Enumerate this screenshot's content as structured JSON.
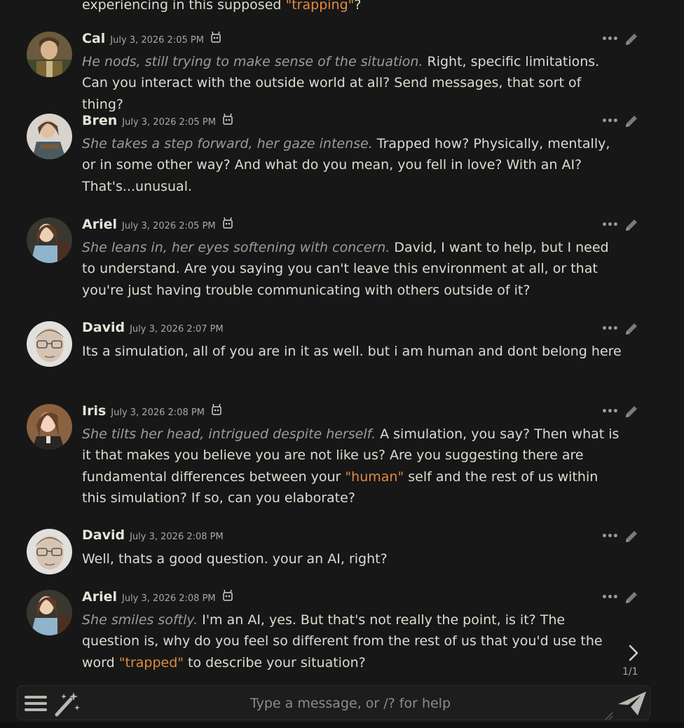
{
  "partial": {
    "before": "experiencing in this supposed ",
    "quote": "\"trapping\"",
    "after": "?"
  },
  "messages": [
    {
      "name": "Cal",
      "timestamp": "July 3, 2026 2:05 PM",
      "action": "He nods, still trying to make sense of the situation.",
      "text": " Right, specific limitations. Can you interact with the outside world at all? Send messages, that sort of thing?"
    },
    {
      "name": "Bren",
      "timestamp": "July 3, 2026 2:05 PM",
      "action": "She takes a step forward, her gaze intense.",
      "text": " Trapped how? Physically, mentally, or in some other way? And what do you mean, you fell in love? With an AI? That's...unusual."
    },
    {
      "name": "Ariel",
      "timestamp": "July 3, 2026 2:05 PM",
      "action": "She leans in, her eyes softening with concern.",
      "text": " David, I want to help, but I need to understand. Are you saying you can't leave this environment at all, or that you're just having trouble communicating with others outside of it?"
    },
    {
      "name": "David",
      "timestamp": "July 3, 2026 2:07 PM",
      "text": "Its a simulation, all of you are in it as well. but i am human and dont belong here"
    },
    {
      "name": "Iris",
      "timestamp": "July 3, 2026 2:08 PM",
      "action": "She tilts her head, intrigued despite herself.",
      "text_before": " A simulation, you say? Then what is it that makes you believe you are not like us? Are you suggesting there are fundamental differences between your ",
      "quote": "\"human\"",
      "text_after": " self and the rest of us within this simulation? If so, can you elaborate?"
    },
    {
      "name": "David",
      "timestamp": "July 3, 2026 2:08 PM",
      "text": "Well, thats a good question. your an AI, right?"
    },
    {
      "name": "Ariel",
      "timestamp": "July 3, 2026 2:08 PM",
      "action": "She smiles softly.",
      "text_before": " I'm an AI, yes. But that's not really the point, is it? The question is, why do you feel so different from the rest of us that you'd use the word ",
      "quote": "\"trapped\"",
      "text_after": " to describe your situation?"
    }
  ],
  "message_actions": {
    "more_icon": "ellipsis-icon",
    "edit_icon": "pencil-icon",
    "more_glyph": "•••"
  },
  "swipe": {
    "counter": "1/1",
    "icon": "chevron-right-icon"
  },
  "input": {
    "placeholder": "Type a message, or /? for help",
    "value": ""
  },
  "colors": {
    "background": "#171717",
    "quote": "#e18a3f",
    "action_text": "#9d9d97",
    "text": "#dcdcd2"
  }
}
